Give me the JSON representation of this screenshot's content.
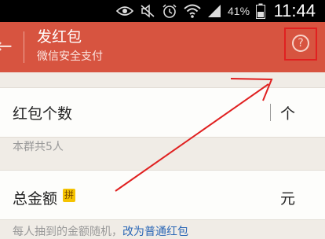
{
  "status_bar": {
    "battery_percent": "41%",
    "time": "11:44",
    "icons": [
      "eye-icon",
      "mute-icon",
      "alarm-icon",
      "wifi-icon",
      "signal-icon",
      "battery-icon"
    ]
  },
  "header": {
    "title": "发红包",
    "subtitle": "微信安全支付",
    "help_icon_glyph": "?"
  },
  "form": {
    "count_label": "红包个数",
    "count_unit": "个",
    "count_hint": "本群共5人",
    "amount_label": "总金额",
    "amount_badge": "拼",
    "amount_unit": "元",
    "amount_hint": "每人抽到的金额随机，",
    "switch_link": "改为普通红包"
  },
  "colors": {
    "header_bg": "#d75440",
    "annotation_red": "#e02020",
    "badge_bg": "#f5c300",
    "link_blue": "#2b67b6"
  }
}
